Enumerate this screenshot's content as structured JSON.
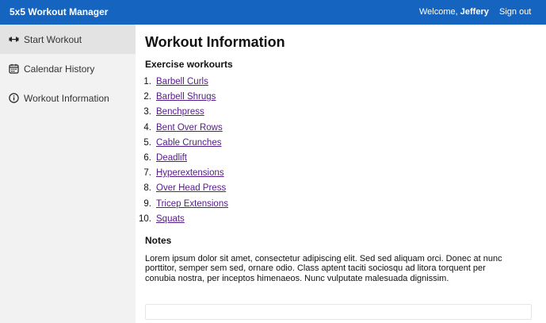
{
  "header": {
    "brand": "5x5 Workout Manager",
    "welcome_prefix": "Welcome, ",
    "username": "Jeffery",
    "signout_label": "Sign out",
    "bg_color": "#1565c0"
  },
  "sidebar": {
    "items": [
      {
        "label": "Start Workout",
        "icon": "dumbbell-icon",
        "active": true
      },
      {
        "label": "Calendar History",
        "icon": "calendar-icon",
        "active": false
      },
      {
        "label": "Workout Information",
        "icon": "info-icon",
        "active": false
      }
    ]
  },
  "main": {
    "title": "Workout Information",
    "subheading": "Exercise workourts",
    "exercises": [
      {
        "num": "1.",
        "label": "Barbell Curls"
      },
      {
        "num": "2.",
        "label": "Barbell Shrugs"
      },
      {
        "num": "3.",
        "label": "Benchpress"
      },
      {
        "num": "4.",
        "label": "Bent Over Rows"
      },
      {
        "num": "5.",
        "label": "Cable Crunches"
      },
      {
        "num": "6.",
        "label": "Deadlift"
      },
      {
        "num": "7.",
        "label": "Hyperextensions"
      },
      {
        "num": "8.",
        "label": "Over Head Press"
      },
      {
        "num": "9.",
        "label": "Tricep Extensions"
      },
      {
        "num": "10.",
        "label": "Squats"
      }
    ],
    "notes_heading": "Notes",
    "notes_text": "Lorem ipsum dolor sit amet, consectetur adipiscing elit. Sed sed aliquam orci. Donec at nunc porttitor, semper sem sed, ornare odio. Class aptent taciti sociosqu ad litora torquent per conubia nostra, per inceptos himenaeos. Nunc vulputate malesuada dignissim."
  }
}
